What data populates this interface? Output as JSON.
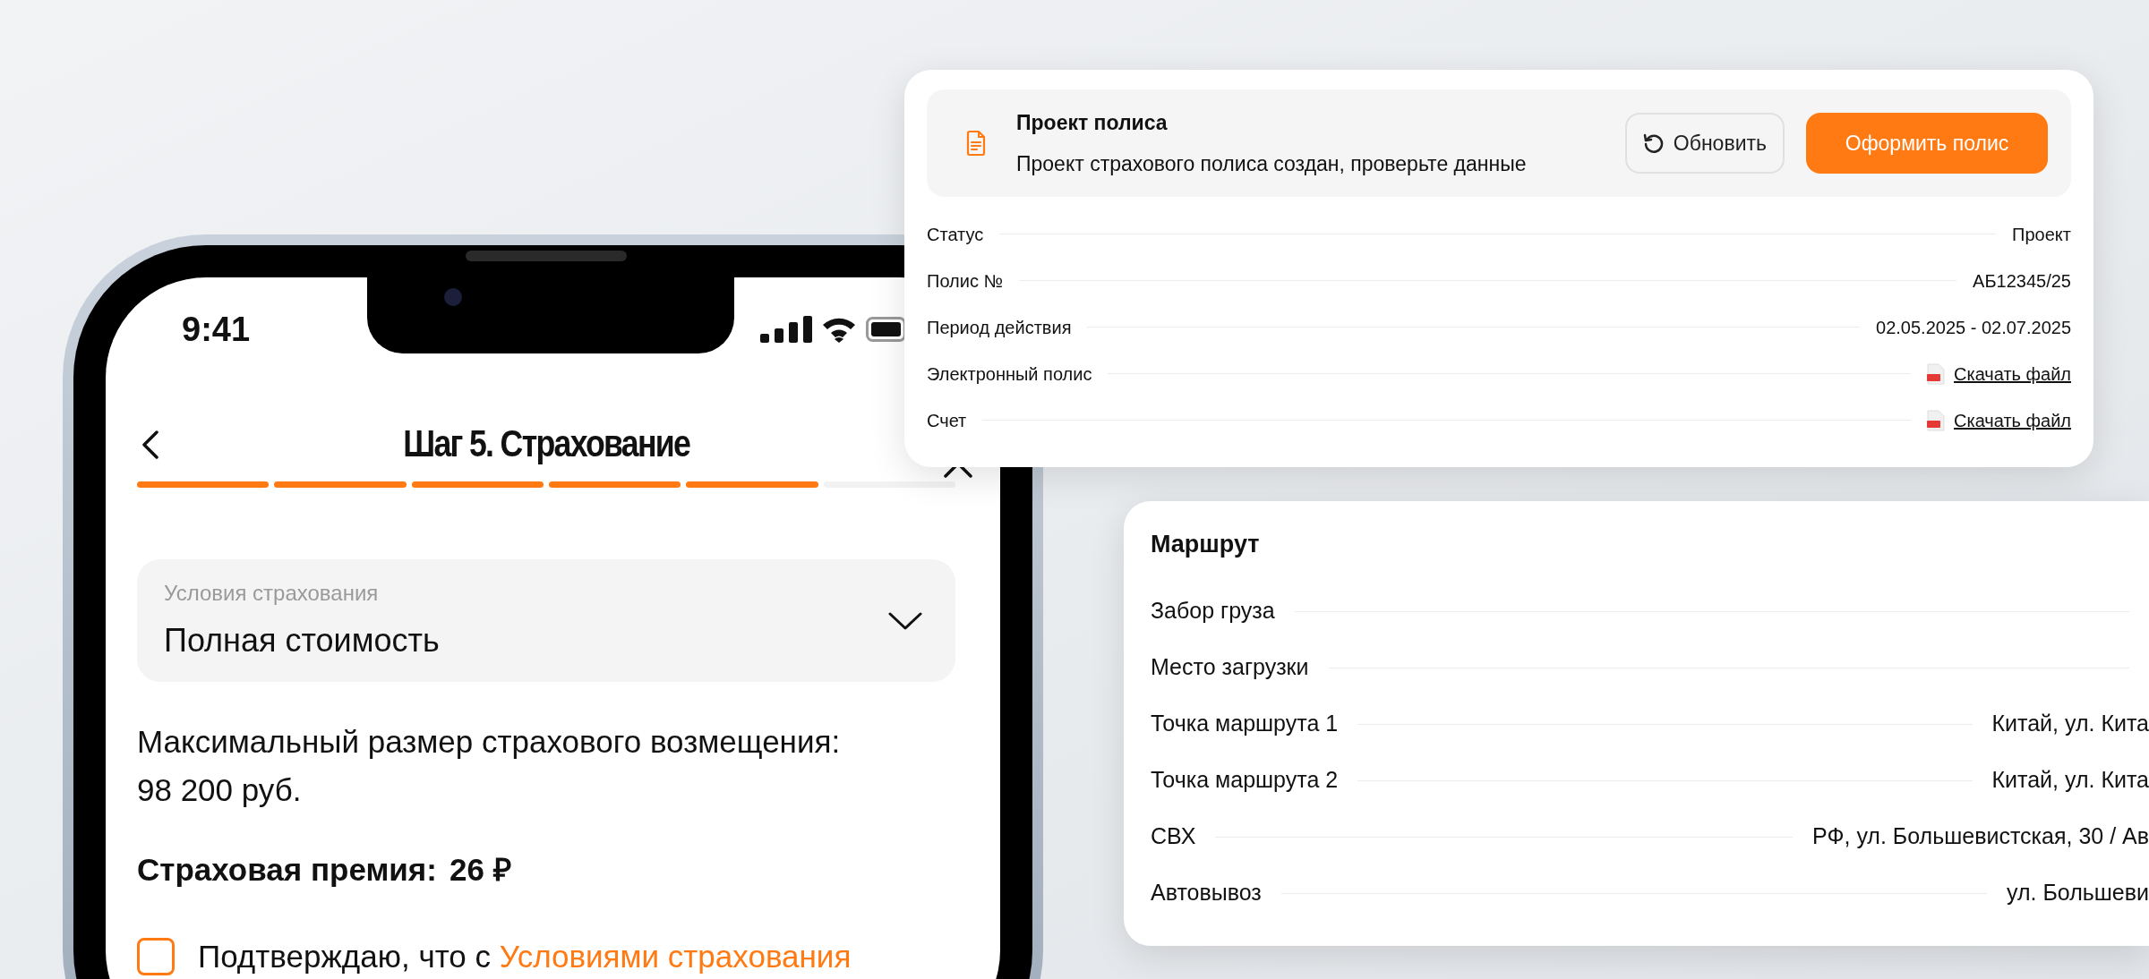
{
  "phone": {
    "status_bar": {
      "time": "9:41"
    },
    "header": {
      "title": "Шаг 5. Страхование"
    },
    "progress_steps": [
      {
        "done": true
      },
      {
        "done": true
      },
      {
        "done": true
      },
      {
        "done": true
      },
      {
        "done": true
      },
      {
        "done": false
      }
    ],
    "insurance_terms": {
      "label": "Условия страхования",
      "value": "Полная стоимость"
    },
    "max_compensation": "Максимальный размер страхового возмещения: 98 200 руб.",
    "premium": {
      "label": "Страховая премия:",
      "value": "26 ₽"
    },
    "confirmation": {
      "checked": false,
      "text": "Подтверждаю, что с",
      "link": "Условиями страхования"
    }
  },
  "policy_card": {
    "title": "Проект полиса",
    "subtitle": "Проект страхового полиса создан, проверьте данные",
    "buttons": [
      {
        "kind": "refresh",
        "label": "Обновить"
      },
      {
        "kind": "primary",
        "label": "Оформить полис"
      }
    ],
    "rows": [
      {
        "kind": "text",
        "label": "Статус",
        "value": "Проект"
      },
      {
        "kind": "text",
        "label": "Полис №",
        "value": "АБ12345/25"
      },
      {
        "kind": "text",
        "label": "Период действия",
        "value": "02.05.2025 - 02.07.2025"
      },
      {
        "kind": "file",
        "label": "Электронный полис",
        "value": "Скачать файл"
      },
      {
        "kind": "file",
        "label": "Счет",
        "value": "Скачать файл"
      }
    ]
  },
  "route_card": {
    "title": "Маршрут",
    "rows": [
      {
        "label": "Забор груза"
      },
      {
        "label": "Место загрузки"
      },
      {
        "label": "Точка маршрута 1",
        "value": "Китай, ул. Кита"
      },
      {
        "label": "Точка маршрута 2",
        "value": "Китай, ул. Кита"
      },
      {
        "label": "СВХ",
        "value": "РФ, ул. Большевистская, 30 / Ав"
      },
      {
        "label": "Автовывоз",
        "value": "ул. Большеви"
      }
    ]
  }
}
